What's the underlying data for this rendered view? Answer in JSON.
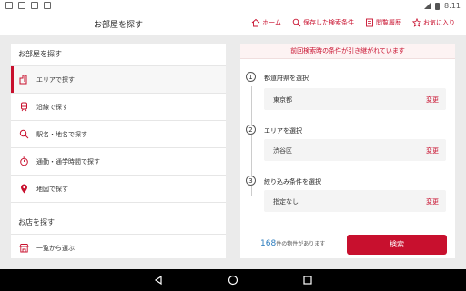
{
  "status": {
    "time": "8:11"
  },
  "header": {
    "title": "お部屋を探す",
    "nav": [
      {
        "label": "ホーム",
        "icon": "home-icon"
      },
      {
        "label": "保存した検索条件",
        "icon": "saved-search-icon"
      },
      {
        "label": "閲覧履歴",
        "icon": "history-icon"
      },
      {
        "label": "お気に入り",
        "icon": "star-icon"
      }
    ]
  },
  "left": {
    "room_section": "お部屋を探す",
    "items": [
      {
        "label": "エリアで探す",
        "icon": "building-icon"
      },
      {
        "label": "沿線で探す",
        "icon": "train-icon"
      },
      {
        "label": "駅名・地名で探す",
        "icon": "search-place-icon"
      },
      {
        "label": "通勤・通学時間で探す",
        "icon": "stopwatch-icon"
      },
      {
        "label": "地図で探す",
        "icon": "map-pin-icon"
      }
    ],
    "shop_section": "お店を探す",
    "shop_items": [
      {
        "label": "一覧から選ぶ",
        "icon": "shop-icon"
      }
    ]
  },
  "right": {
    "banner": "前回検索時の条件が引き継がれています",
    "steps": [
      {
        "num": "1",
        "label": "都道府県を選択",
        "value": "東京都",
        "change": "変更"
      },
      {
        "num": "2",
        "label": "エリアを選択",
        "value": "渋谷区",
        "change": "変更"
      },
      {
        "num": "3",
        "label": "絞り込み条件を選択",
        "value": "指定なし",
        "change": "変更"
      }
    ],
    "count_value": "168",
    "count_suffix": "件の物件があります",
    "search_button": "検索"
  },
  "colors": {
    "accent": "#c8102e",
    "count": "#2a7bbd"
  }
}
